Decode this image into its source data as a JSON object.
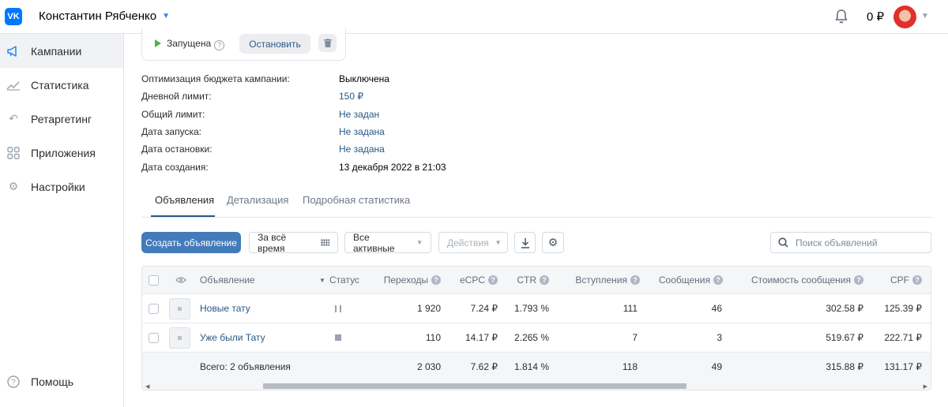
{
  "header": {
    "logo": "VK",
    "account_name": "Константин Рябченко",
    "balance": "0 ₽"
  },
  "sidebar": {
    "items": [
      {
        "label": "Кампании",
        "icon": "megaphone-icon",
        "active": true
      },
      {
        "label": "Статистика",
        "icon": "chart-icon",
        "active": false
      },
      {
        "label": "Ретаргетинг",
        "icon": "retarget-icon",
        "active": false
      },
      {
        "label": "Приложения",
        "icon": "apps-icon",
        "active": false
      },
      {
        "label": "Настройки",
        "icon": "gear-icon",
        "active": false
      }
    ],
    "help_label": "Помощь"
  },
  "campaign": {
    "status": "Запущена",
    "stop_label": "Остановить",
    "info": [
      {
        "label": "Оптимизация бюджета кампании:",
        "value": "Выключена"
      },
      {
        "label": "Дневной лимит:",
        "value": "150 ₽"
      },
      {
        "label": "Общий лимит:",
        "value": "Не задан"
      },
      {
        "label": "Дата запуска:",
        "value": "Не задана"
      },
      {
        "label": "Дата остановки:",
        "value": "Не задана"
      },
      {
        "label": "Дата создания:",
        "value": "13 декабря 2022 в 21:03"
      }
    ]
  },
  "tabs": [
    "Объявления",
    "Детализация",
    "Подробная статистика"
  ],
  "toolbar": {
    "create_label": "Создать объявление",
    "period_label": "За всё время",
    "filter_label": "Все активные",
    "actions_label": "Действия",
    "search_placeholder": "Поиск объявлений"
  },
  "table": {
    "columns": [
      "Объявление",
      "Статус",
      "Переходы",
      "eCPC",
      "CTR",
      "Вступления",
      "Сообщения",
      "Стоимость сообщения",
      "CPF"
    ],
    "rows": [
      {
        "name": "Новые тату",
        "status": "paused",
        "clicks": "1 920",
        "ecpc": "7.24 ₽",
        "ctr": "1.793 %",
        "joins": "111",
        "messages": "46",
        "msg_cost": "302.58 ₽",
        "cpf": "125.39 ₽"
      },
      {
        "name": "Уже были Тату",
        "status": "stopped",
        "clicks": "110",
        "ecpc": "14.17 ₽",
        "ctr": "2.265 %",
        "joins": "7",
        "messages": "3",
        "msg_cost": "519.67 ₽",
        "cpf": "222.71 ₽"
      }
    ],
    "total": {
      "label": "Всего: 2 объявления",
      "clicks": "2 030",
      "ecpc": "7.62 ₽",
      "ctr": "1.814 %",
      "joins": "118",
      "messages": "49",
      "msg_cost": "315.88 ₽",
      "cpf": "131.17 ₽"
    }
  }
}
